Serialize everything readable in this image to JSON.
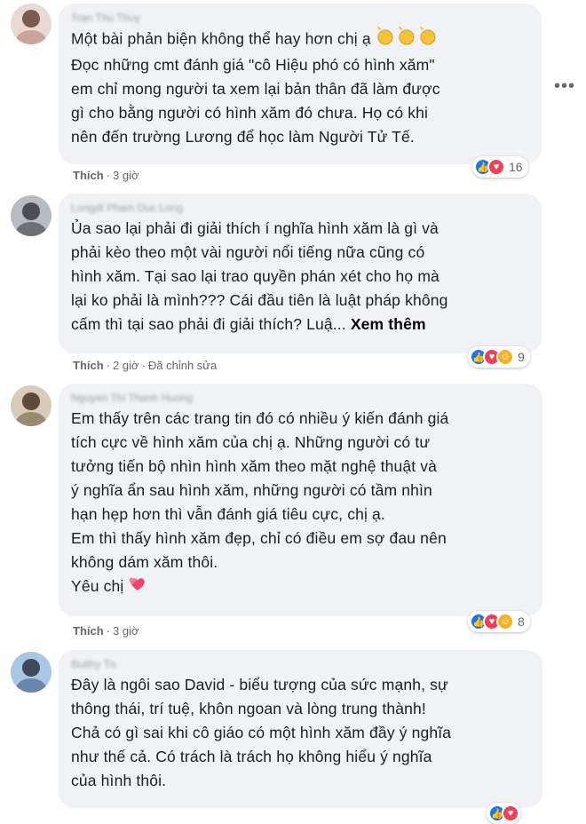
{
  "comments": [
    {
      "author": "Tran Thu Thuy",
      "lines": [
        "Một bài phản biện không thể hay hơn chị ạ",
        "Đọc những cmt đánh giá \"cô Hiệu phó có hình xăm\"",
        "em chỉ mong người ta xem lại bản thân đã làm được",
        "gì cho bằng người có hình xăm đó chưa. Họ có khi",
        "nên đến trường Lương để học làm Người Tử Tế."
      ],
      "like_label": "Thích",
      "time": "3 giờ",
      "reaction_count": "16"
    },
    {
      "author": "Longdt Pham Duc Long",
      "lines": [
        "Ủa sao lại phải đi giải thích í nghĩa hình xăm là gì và",
        "phải kèo theo một vài người nổi tiếng nữa cũng có",
        "hình xăm. Tại sao lại trao quyền phán xét cho họ mà",
        "lại ko phải là mình??? Cái đầu tiên là luật pháp không",
        "cấm thì tại sao phải đi giải thích? Luậ..."
      ],
      "see_more": "Xem thêm",
      "like_label": "Thích",
      "time": "2 giờ",
      "edited": "Đã chỉnh sửa",
      "reaction_count": "9"
    },
    {
      "author": "Nguyen Thi Thanh Huong",
      "lines": [
        "Em thấy trên các trang tin đó có nhiều ý kiến đánh giá",
        "tích cực về hình xăm của chị ạ. Những người có tư",
        "tưởng tiến bộ nhìn hình xăm theo mặt nghệ thuật và",
        "ý nghĩa ẩn sau hình xăm, những người có tầm nhìn",
        "hạn hẹp hơn thì vẫn đánh giá tiêu cực, chị ạ.",
        "Em thì thấy hình xăm đẹp, chỉ có điều em sợ đau nên",
        "không dám xăm thôi.",
        "Yêu chị"
      ],
      "like_label": "Thích",
      "time": "3 giờ",
      "reaction_count": "8"
    },
    {
      "author": "Buithy Tn",
      "lines": [
        "Đây là ngôi sao David - biểu tượng của sức mạnh, sự",
        "thông thái, trí tuệ, khôn ngoan và lòng trung thành!",
        "Chả có gì sai khi cô giáo có một hình xăm đầy ý nghĩa",
        "như thế cả. Có trách là trách họ không hiểu ý nghĩa",
        "của hình thôi."
      ]
    }
  ],
  "colors": {
    "bubble": "#f0f2f5",
    "like": "#1877f2",
    "love": "#f33e58",
    "care": "#f7b125",
    "meta": "#65676b"
  }
}
